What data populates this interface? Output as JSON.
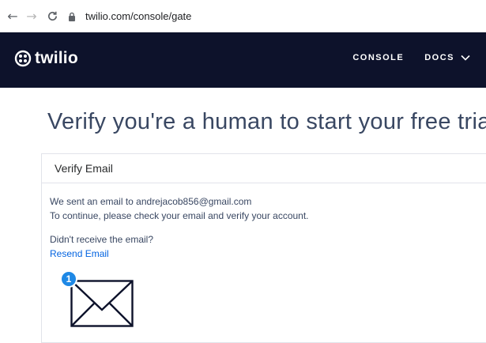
{
  "browser": {
    "back_glyph": "←",
    "forward_glyph": "→",
    "reload_glyph": "C",
    "url": "twilio.com/console/gate"
  },
  "header": {
    "logo_text": "twilio",
    "nav": [
      {
        "label": "CONSOLE"
      },
      {
        "label": "DOCS"
      }
    ],
    "background": "#0d122b"
  },
  "main": {
    "title": "Verify you're a human to start your free trial",
    "card": {
      "title": "Verify Email",
      "line1": "We sent an email to andrejacob856@gmail.com",
      "line2": "To continue, please check your email and verify your account.",
      "question": "Didn't receive the email?",
      "resend": "Resend Email"
    },
    "badge": "1"
  },
  "colors": {
    "accent_link": "#0263e0",
    "badge": "#1e88e5",
    "title_text": "#394762"
  }
}
